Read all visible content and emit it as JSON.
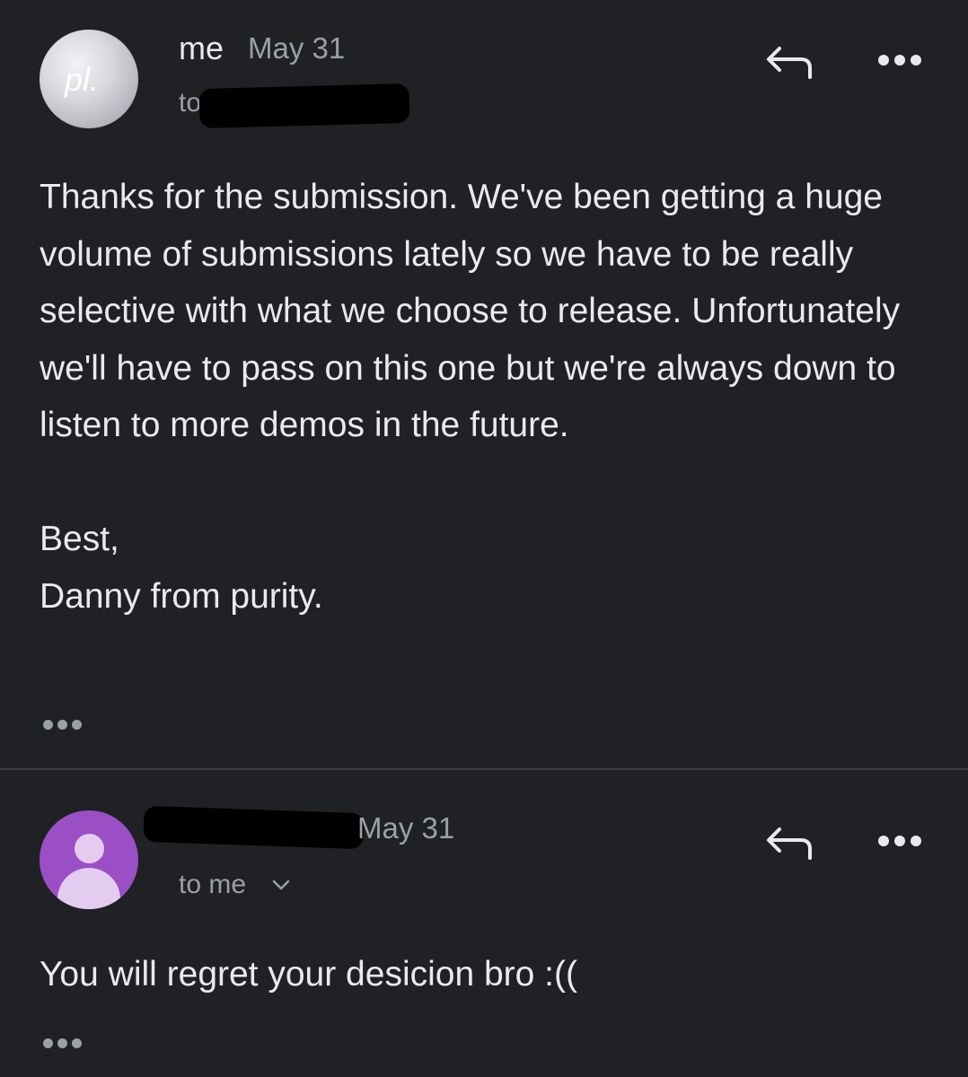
{
  "messages": [
    {
      "sender": "me",
      "date": "May 31",
      "recipient_prefix": "to",
      "avatar_text": "pl.",
      "avatar_color": "#c9c7cd",
      "body_paragraphs": [
        "Thanks for the submission. We've been getting a huge volume of submissions lately so we have to be really selective with what we choose to release. Unfortunately we'll have to pass on this one but we're always down to listen to more demos in the future."
      ],
      "signoff": "Best,",
      "signature": "Danny from purity."
    },
    {
      "sender": "",
      "date": "May 31",
      "recipient": "to me",
      "avatar_color": "#9b4fc4",
      "body_paragraphs": [
        "You will regret your desicion bro :(("
      ]
    }
  ],
  "icons": {
    "reply": "reply-arrow-icon",
    "more": "more-horizontal-icon",
    "expand": "chevron-down-icon",
    "trimmed": "ellipsis-icon",
    "generic_avatar": "person-icon"
  },
  "colors": {
    "background": "#202124",
    "text_primary": "#e8eaed",
    "text_secondary": "#9aa0a6",
    "divider": "#3c3d40"
  }
}
